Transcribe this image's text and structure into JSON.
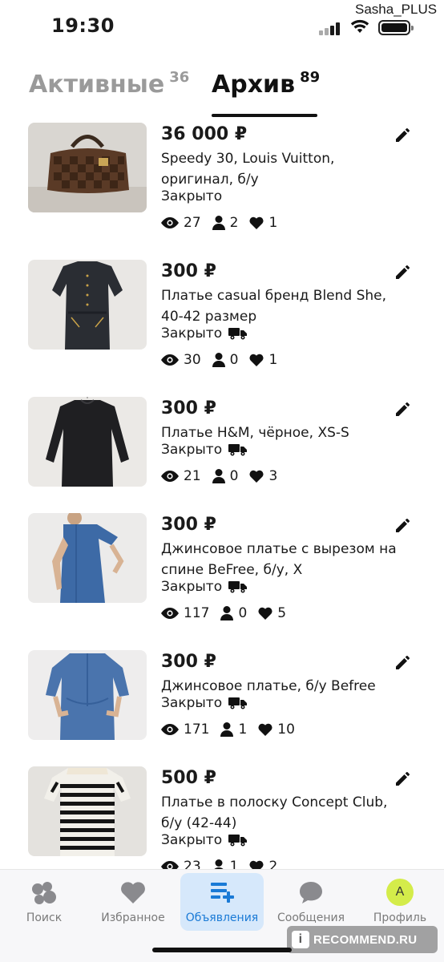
{
  "status_bar": {
    "time": "19:30",
    "user": "Sasha_PLUS"
  },
  "tabs": [
    {
      "label": "Активные",
      "count": "36"
    },
    {
      "label": "Архив",
      "count": "89"
    }
  ],
  "listings": [
    {
      "price": "36 000 ₽",
      "title": "Speedy 30, Louis Vuitton, оригинал, б/у",
      "status": "Закрыто",
      "delivery": false,
      "views": "27",
      "contacts": "2",
      "likes": "1",
      "image": "checkered-handbag"
    },
    {
      "price": "300 ₽",
      "title": "Платье casual бренд Blend She, 40-42 размер",
      "status": "Закрыто",
      "delivery": true,
      "views": "30",
      "contacts": "0",
      "likes": "1",
      "image": "dark-shirt-dress"
    },
    {
      "price": "300 ₽",
      "title": "Платье H&M, чёрное, XS-S",
      "status": "Закрыто",
      "delivery": true,
      "views": "21",
      "contacts": "0",
      "likes": "3",
      "image": "black-dress"
    },
    {
      "price": "300 ₽",
      "title": "Джинсовое платье с вырезом на спине BeFree, б/у, X",
      "status": "Закрыто",
      "delivery": true,
      "views": "117",
      "contacts": "0",
      "likes": "5",
      "image": "denim-dress"
    },
    {
      "price": "300 ₽",
      "title": "Джинсовое платье, б/у Befree",
      "status": "Закрыто",
      "delivery": true,
      "views": "171",
      "contacts": "1",
      "likes": "10",
      "image": "denim-shirt-dress"
    },
    {
      "price": "500 ₽",
      "title": "Платье в полоску Concept Club, б/у (42-44)",
      "status": "Закрыто",
      "delivery": true,
      "views": "23",
      "contacts": "1",
      "likes": "2",
      "image": "striped-dress"
    }
  ],
  "nav": [
    {
      "label": "Поиск",
      "icon": "search-bubbles-icon"
    },
    {
      "label": "Избранное",
      "icon": "heart-icon"
    },
    {
      "label": "Объявления",
      "icon": "listings-add-icon",
      "active": true
    },
    {
      "label": "Сообщения",
      "icon": "chat-bubble-icon"
    },
    {
      "label": "Профиль",
      "icon": "avatar",
      "avatar_letter": "A"
    }
  ],
  "watermark": "RECOMMEND.RU",
  "colors": {
    "accent": "#1a7ad6",
    "active_nav_bg": "#d6e8fb",
    "avatar_bg": "#d4ec4a",
    "inactive_tab": "#9a9a9a"
  }
}
